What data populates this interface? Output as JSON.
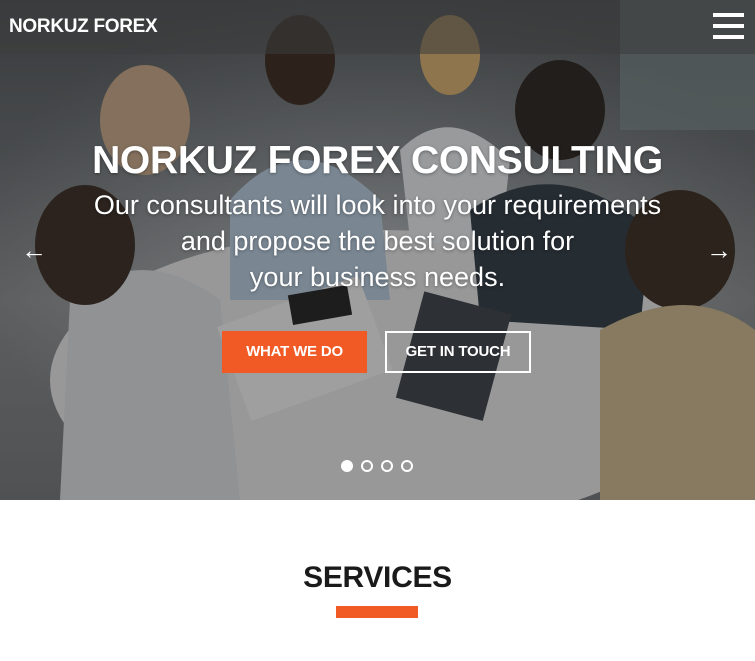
{
  "navbar": {
    "brand": "NORKUZ FOREX",
    "menu_icon": "hamburger-menu-icon"
  },
  "hero": {
    "title": "NORKUZ FOREX CONSULTING",
    "subtitle_lines": [
      "Our consultants will look into your requirements",
      "and propose the best solution for",
      "your business needs."
    ],
    "buttons": {
      "primary_label": "WHAT WE DO",
      "secondary_label": "GET IN TOUCH"
    },
    "arrows": {
      "prev": "←",
      "next": "→"
    },
    "slides": {
      "count": 4,
      "active_index": 0
    },
    "overlay_color": "#141414"
  },
  "services": {
    "title": "SERVICES"
  },
  "colors": {
    "accent": "#f15a24",
    "text_dark": "#1a1a1a",
    "white": "#ffffff"
  }
}
